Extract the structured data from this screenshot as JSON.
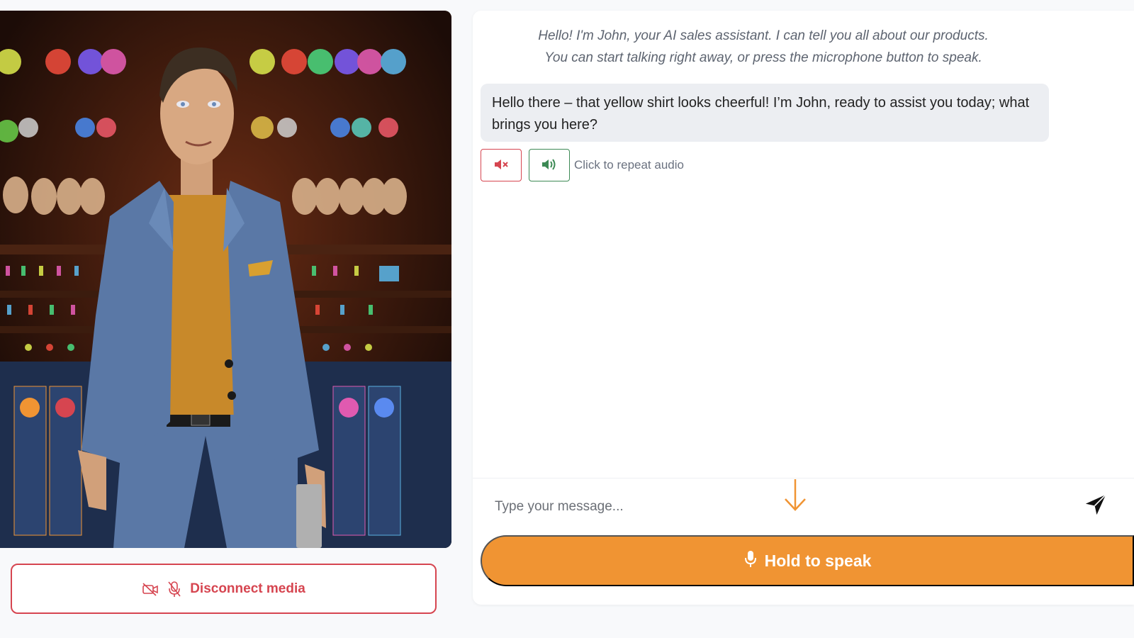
{
  "avatar": {
    "name": "John",
    "shirt_color": "#c8892a",
    "suit_color": "#5a78a6",
    "background_color": "#3a1b10"
  },
  "media": {
    "disconnect_label": "Disconnect media",
    "icons": [
      "video-off-icon",
      "mic-off-icon"
    ],
    "accent": "#d64550"
  },
  "chat": {
    "intro_line1": "Hello! I'm John, your AI sales assistant. I can tell you all about our products.",
    "intro_line2": "You can start talking right away, or press the microphone button to speak.",
    "messages": [
      {
        "role": "assistant",
        "text": "Hello there – that yellow shirt looks cheerful! I’m John, ready to assist you today; what brings you here?"
      }
    ],
    "audio": {
      "repeat_label": "Click to repeat audio",
      "mute_icon": "speaker-mute-icon",
      "play_icon": "speaker-volume-icon"
    },
    "input": {
      "placeholder": "Type your message..."
    },
    "speak_label": "Hold to speak",
    "accent": "#f09433"
  }
}
